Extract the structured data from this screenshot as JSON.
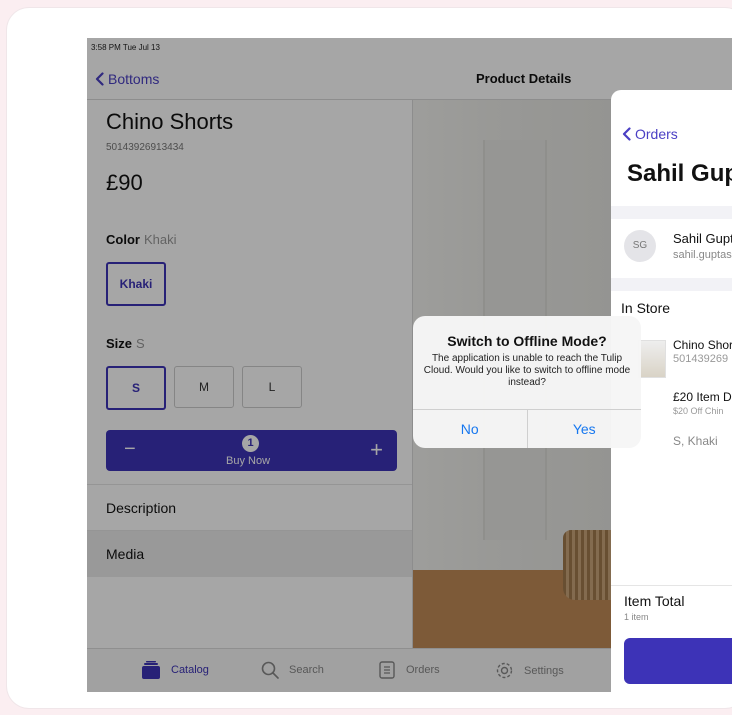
{
  "status_bar": {
    "time": "3:58 PM  Tue Jul 13"
  },
  "nav": {
    "back_label": "Bottoms",
    "title": "Product Details"
  },
  "product": {
    "name": "Chino Shorts",
    "sku": "50143926913434",
    "price": "£90",
    "color_label": "Color",
    "color_value": "Khaki",
    "color_options": [
      "Khaki"
    ],
    "size_label": "Size",
    "size_value": "S",
    "size_options": [
      "S",
      "M",
      "L"
    ],
    "quantity": "1",
    "buy_label": "Buy Now",
    "minus": "−",
    "plus": "+"
  },
  "sections": {
    "description": "Description",
    "media": "Media"
  },
  "tabbar": {
    "catalog": "Catalog",
    "search": "Search",
    "orders": "Orders",
    "settings": "Settings"
  },
  "order_panel": {
    "back_label": "Orders",
    "customer_name_heading": "Sahil Gup",
    "avatar_initials": "SG",
    "customer_name": "Sahil Gupt",
    "customer_email": "sahil.guptas",
    "section_label": "In Store",
    "item_name": "Chino Shor",
    "item_sku": "501439269",
    "discount_name": "£20 Item D",
    "discount_sub": "$20 Off Chin",
    "variant": "S, Khaki",
    "total_label": "Item Total",
    "total_sub": "1 item"
  },
  "alert": {
    "title": "Switch to Offline Mode?",
    "message": "The application is unable to reach the Tulip Cloud. Would you like to switch to offline mode instead?",
    "no_label": "No",
    "yes_label": "Yes"
  },
  "colors": {
    "accent": "#3d33b7",
    "link": "#4a3fc4",
    "alert_button": "#1677ef"
  },
  "icons": [
    "chevron-left-icon",
    "catalog-icon",
    "search-icon",
    "orders-icon",
    "settings-icon"
  ]
}
